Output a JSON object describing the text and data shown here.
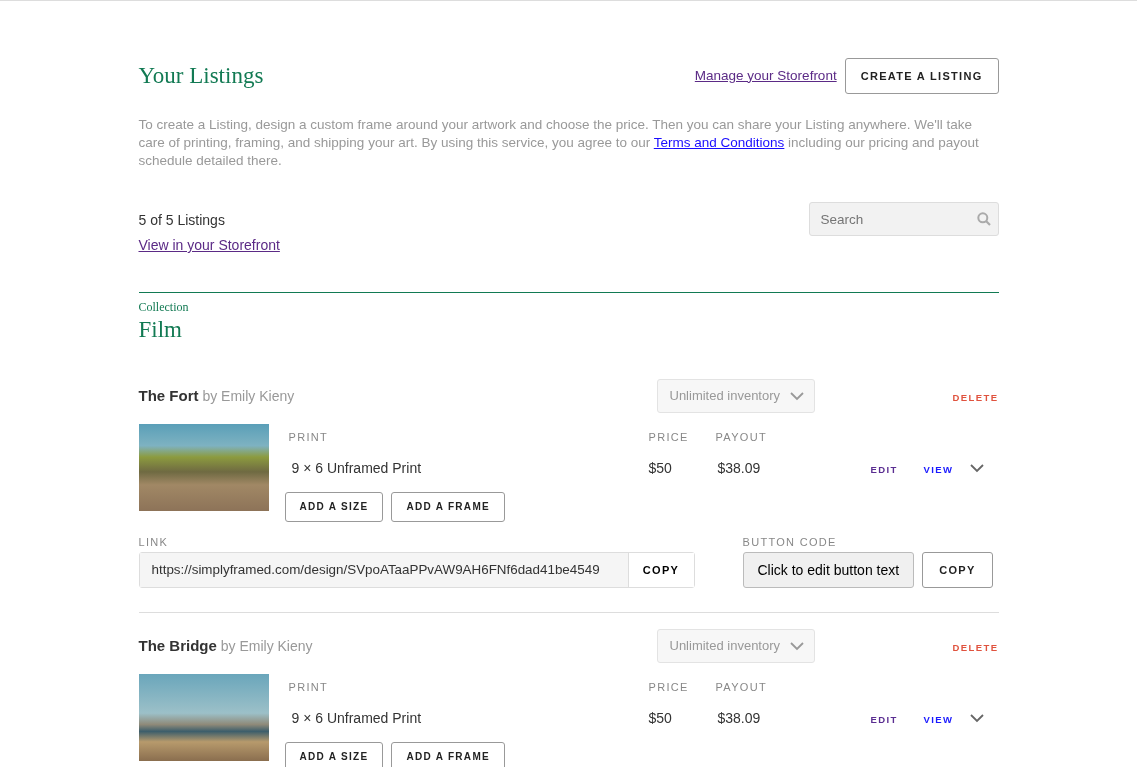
{
  "header": {
    "title": "Your Listings",
    "manage_link": "Manage your Storefront",
    "create_button": "CREATE A LISTING"
  },
  "intro": {
    "text": "To create a Listing, design a custom frame around your artwork and choose the price. Then you can share your Listing anywhere. We'll take care of printing, framing, and shipping your art. By using this service, you agree to our ",
    "link": "Terms and Conditions",
    "text_after": " including our pricing and payout schedule detailed there."
  },
  "summary": {
    "count": "5 of 5 Listings",
    "storefront_link": "View in your Storefront"
  },
  "search": {
    "placeholder": "Search"
  },
  "collection": {
    "label": "Collection",
    "name": "Film"
  },
  "listings": [
    {
      "title": "The Fort",
      "artist": "by Emily Kieny",
      "inventory": {
        "value": "Unlimited inventory",
        "disabled": true
      },
      "delete": "DELETE",
      "columns": {
        "print": "PRINT",
        "price": "PRICE",
        "payout": "PAYOUT"
      },
      "print": {
        "size": "9 × 6",
        "type": "Unframed Print",
        "price": "$50",
        "payout": "$38.09",
        "edit": "EDIT",
        "view": "VIEW"
      },
      "buttons": [
        "ADD A SIZE",
        "ADD A FRAME"
      ],
      "link": {
        "label": "LINK",
        "url": "https://simplyframed.com/design/SVpoATaaPPvAW9AH6FNf6dad41be4549",
        "copy": "COPY"
      },
      "button_code": {
        "label": "BUTTON CODE",
        "text": "Click to edit button text",
        "copy": "COPY"
      }
    },
    {
      "title": "The Bridge",
      "artist": "by Emily Kieny",
      "inventory": {
        "value": "Unlimited inventory",
        "disabled": true
      },
      "delete": "DELETE",
      "columns": {
        "print": "PRINT",
        "price": "PRICE",
        "payout": "PAYOUT"
      },
      "print": {
        "size": "9 × 6",
        "type": "Unframed Print",
        "price": "$50",
        "payout": "$38.09",
        "edit": "EDIT",
        "view": "VIEW"
      },
      "buttons": [
        "ADD A SIZE",
        "ADD A FRAME"
      ]
    }
  ]
}
